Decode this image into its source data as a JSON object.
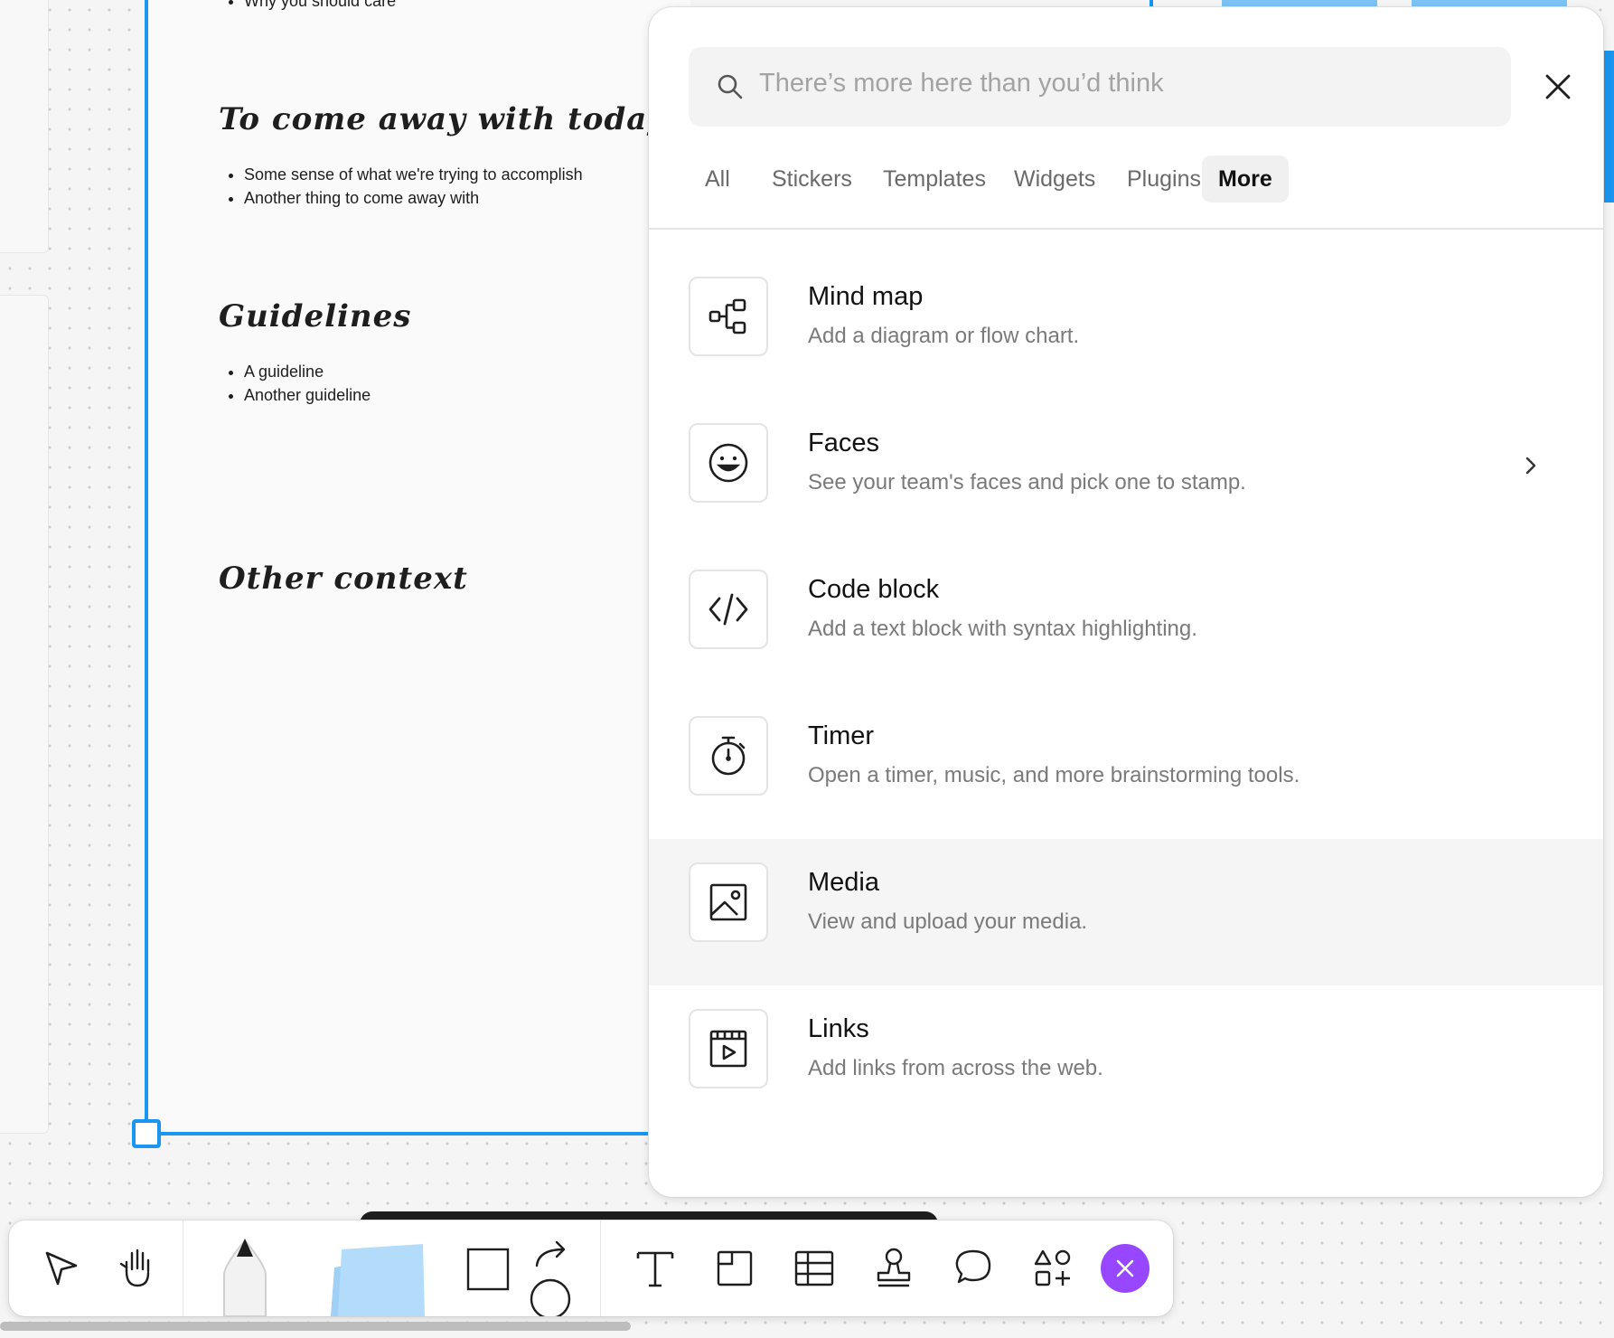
{
  "canvas": {
    "section": {
      "top_bullet": "Why you should care",
      "heading_1": "To come away with today...",
      "bullets_1": [
        "Some sense of what we're trying to accomplish",
        "Another thing to come away with"
      ],
      "heading_2": "Guidelines",
      "bullets_2": [
        "A guideline",
        "Another guideline"
      ],
      "heading_3": "Other context"
    },
    "selection_color": "#1a96f0"
  },
  "panel": {
    "search_placeholder": "There’s more here than you’d think",
    "tabs": [
      "All",
      "Stickers",
      "Templates",
      "Widgets",
      "Plugins",
      "More"
    ],
    "active_tab": "More",
    "items": [
      {
        "icon": "mind-map-icon",
        "title": "Mind map",
        "description": "Add a diagram or flow chart."
      },
      {
        "icon": "faces-icon",
        "title": "Faces",
        "description": "See your team's faces and pick one to stamp."
      },
      {
        "icon": "code-icon",
        "title": "Code block",
        "description": "Add a text block with syntax highlighting."
      },
      {
        "icon": "timer-icon",
        "title": "Timer",
        "description": "Open a timer, music, and more brainstorming tools."
      },
      {
        "icon": "media-icon",
        "title": "Media",
        "description": "View and upload your media."
      },
      {
        "icon": "links-icon",
        "title": "Links",
        "description": "Add links from across the web."
      }
    ],
    "hovered_item": "Media"
  },
  "toolbar": {
    "tools": [
      "move-icon",
      "hand-icon",
      "marker-icon",
      "sticky-note-icon",
      "rectangle-icon",
      "connector-icon",
      "circle-icon",
      "text-icon",
      "section-icon",
      "table-icon",
      "stamp-icon",
      "comment-icon",
      "more-tools-icon",
      "close-icon"
    ],
    "accent": "#9747ff"
  }
}
